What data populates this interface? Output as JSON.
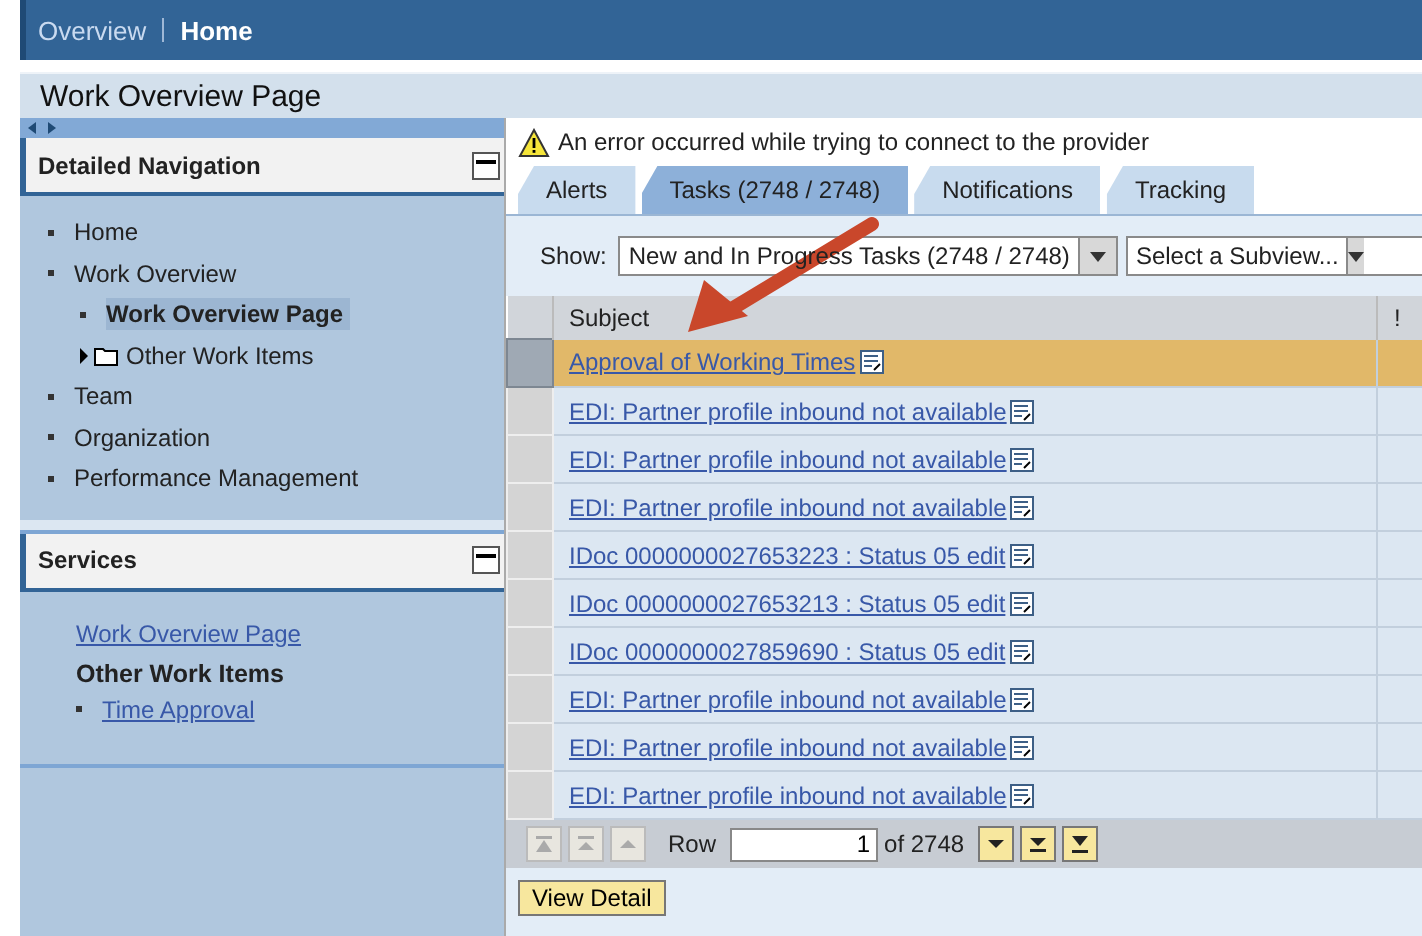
{
  "top_nav": [
    {
      "label": "Overview",
      "selected": false
    },
    {
      "label": "Home",
      "selected": true
    }
  ],
  "page_title": "Work Overview Page",
  "detailed_navigation": {
    "title": "Detailed Navigation",
    "items": [
      {
        "label": "Home",
        "selected": false
      },
      {
        "label": "Work Overview",
        "selected": false,
        "children": [
          {
            "label": "Work Overview Page",
            "selected": true
          },
          {
            "label": "Other Work Items",
            "selected": false,
            "kind": "folder",
            "expanded": false
          }
        ]
      },
      {
        "label": "Team",
        "selected": false
      },
      {
        "label": "Organization",
        "selected": false
      },
      {
        "label": "Performance Management",
        "selected": false
      }
    ]
  },
  "services": {
    "title": "Services",
    "link": "Work Overview Page",
    "heading": "Other Work Items",
    "items": [
      "Time Approval"
    ]
  },
  "message": {
    "kind": "warning",
    "text": "An error occurred while trying to connect to the provider"
  },
  "tabs": [
    {
      "label": "Alerts",
      "selected": false
    },
    {
      "label": "Tasks  (2748 / 2748)",
      "selected": true
    },
    {
      "label": "Notifications",
      "selected": false
    },
    {
      "label": "Tracking",
      "selected": false
    }
  ],
  "filter": {
    "label": "Show:",
    "view": "New and In Progress Tasks  (2748 / 2748)",
    "subview": "Select a Subview..."
  },
  "table": {
    "columns": [
      "Subject",
      "!"
    ],
    "rows": [
      {
        "subject": "Approval of Working Times",
        "selected": true
      },
      {
        "subject": "EDI: Partner profile inbound not available",
        "selected": false
      },
      {
        "subject": "EDI: Partner profile inbound not available",
        "selected": false
      },
      {
        "subject": "EDI: Partner profile inbound not available",
        "selected": false
      },
      {
        "subject": "IDoc 0000000027653223 : Status 05 edit",
        "selected": false
      },
      {
        "subject": "IDoc 0000000027653213 : Status 05 edit",
        "selected": false
      },
      {
        "subject": "IDoc 0000000027859690 : Status 05 edit",
        "selected": false
      },
      {
        "subject": "EDI: Partner profile inbound not available",
        "selected": false
      },
      {
        "subject": "EDI: Partner profile inbound not available",
        "selected": false
      },
      {
        "subject": "EDI: Partner profile inbound not available",
        "selected": false
      }
    ]
  },
  "pager": {
    "label": "Row",
    "row": "1",
    "total": "of 2748"
  },
  "buttons": [
    "View Detail"
  ]
}
